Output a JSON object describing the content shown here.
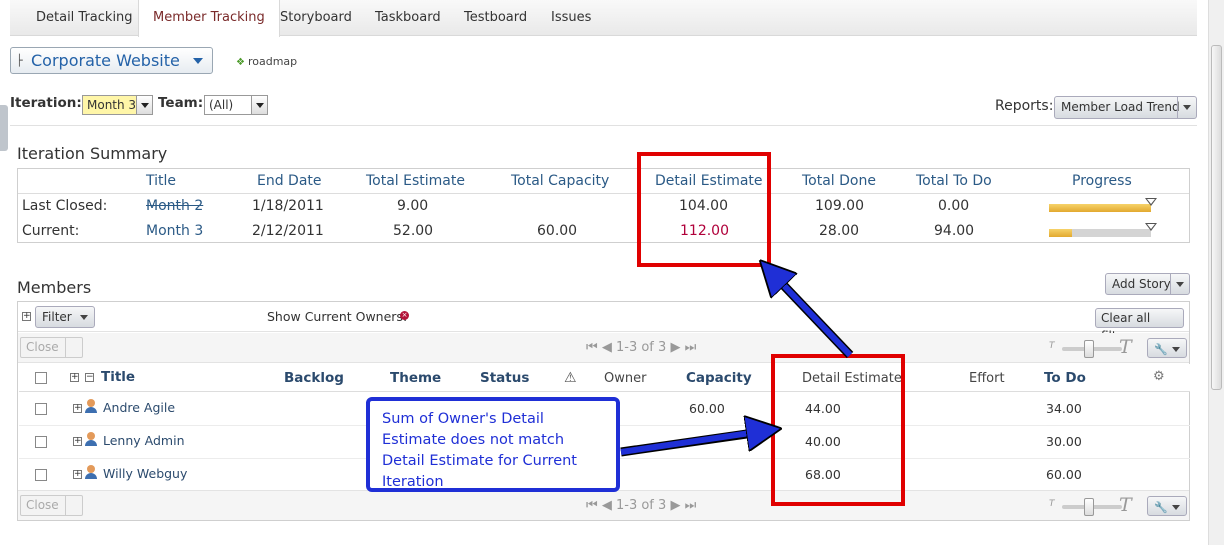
{
  "tabs": [
    "Detail Tracking",
    "Member Tracking",
    "Storyboard",
    "Taskboard",
    "Testboard",
    "Issues"
  ],
  "project": {
    "name": "Corporate Website",
    "roadmap_label": "roadmap"
  },
  "filters": {
    "iteration_label": "Iteration:",
    "iteration_value": "Month 3",
    "team_label": "Team:",
    "team_value": "(All)",
    "reports_label": "Reports:",
    "reports_value": "Member Load Trend"
  },
  "summary": {
    "title": "Iteration Summary",
    "headers": [
      "Title",
      "End Date",
      "Total Estimate",
      "Total Capacity",
      "Detail Estimate",
      "Total Done",
      "Total To Do",
      "Progress"
    ],
    "rows": [
      {
        "label": "Last Closed:",
        "title": "Month 2",
        "end_date": "1/18/2011",
        "total_estimate": "9.00",
        "total_capacity": "",
        "detail_estimate": "104.00",
        "total_done": "109.00",
        "total_todo": "0.00",
        "progress": 1.0,
        "marker": 1.0
      },
      {
        "label": "Current:",
        "title": "Month 3",
        "end_date": "2/12/2011",
        "total_estimate": "52.00",
        "total_capacity": "60.00",
        "detail_estimate": "112.00",
        "total_done": "28.00",
        "total_todo": "94.00",
        "progress": 0.23,
        "marker": 1.0
      }
    ],
    "highlight_color": "#b0003a"
  },
  "members": {
    "title": "Members",
    "add_story": "Add Story",
    "filter_label": "Filter",
    "show_owners_label": "Show Current Owners:",
    "clear_filters": "Clear all filters",
    "close_label": "Close",
    "pager": "1-3 of 3",
    "columns": [
      "Title",
      "Backlog",
      "Theme",
      "Status",
      "Owner",
      "Capacity",
      "Detail Estimate",
      "Effort",
      "To Do"
    ],
    "rows": [
      {
        "name": "Andre Agile",
        "capacity": "60.00",
        "detail_estimate": "44.00",
        "todo": "34.00"
      },
      {
        "name": "Lenny Admin",
        "capacity": "",
        "detail_estimate": "40.00",
        "todo": "30.00"
      },
      {
        "name": "Willy Webguy",
        "capacity": "",
        "detail_estimate": "68.00",
        "todo": "60.00"
      }
    ]
  },
  "annotation": {
    "callout_text": "Sum of Owner's Detail Estimate does not match Detail Estimate for Current Iteration",
    "red_color": "#e00000",
    "blue_color": "#1f2fd6"
  }
}
